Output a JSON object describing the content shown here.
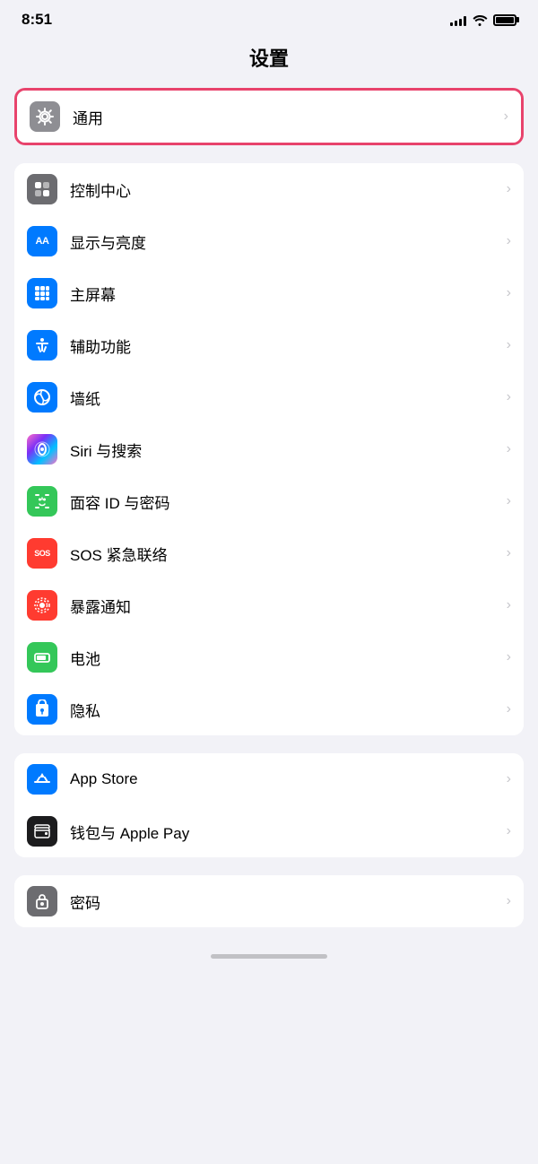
{
  "statusBar": {
    "time": "8:51",
    "signalBars": [
      4,
      6,
      8,
      10,
      12
    ],
    "batteryFull": true
  },
  "pageTitle": "设置",
  "sections": [
    {
      "id": "section-general",
      "highlighted": true,
      "rows": [
        {
          "id": "general",
          "label": "通用",
          "iconBg": "#8e8e93",
          "iconType": "gear"
        }
      ]
    },
    {
      "id": "section-display",
      "rows": [
        {
          "id": "control-center",
          "label": "控制中心",
          "iconBg": "#6c6c70",
          "iconType": "control"
        },
        {
          "id": "display",
          "label": "显示与亮度",
          "iconBg": "#007aff",
          "iconType": "aa"
        },
        {
          "id": "home-screen",
          "label": "主屏幕",
          "iconBg": "#007aff",
          "iconType": "home"
        },
        {
          "id": "accessibility",
          "label": "辅助功能",
          "iconBg": "#007aff",
          "iconType": "accessibility"
        },
        {
          "id": "wallpaper",
          "label": "墙纸",
          "iconBg": "#007aff",
          "iconType": "wallpaper"
        },
        {
          "id": "siri",
          "label": "Siri 与搜索",
          "iconBg": "#000",
          "iconType": "siri"
        },
        {
          "id": "faceid",
          "label": "面容 ID 与密码",
          "iconBg": "#34c759",
          "iconType": "faceid"
        },
        {
          "id": "sos",
          "label": "SOS 紧急联络",
          "iconBg": "#ff3b30",
          "iconType": "sos"
        },
        {
          "id": "exposure",
          "label": "暴露通知",
          "iconBg": "#ff3b30",
          "iconType": "exposure"
        },
        {
          "id": "battery",
          "label": "电池",
          "iconBg": "#34c759",
          "iconType": "battery"
        },
        {
          "id": "privacy",
          "label": "隐私",
          "iconBg": "#007aff",
          "iconType": "privacy"
        }
      ]
    },
    {
      "id": "section-apps",
      "rows": [
        {
          "id": "appstore",
          "label": "App Store",
          "iconBg": "#007aff",
          "iconType": "appstore"
        },
        {
          "id": "wallet",
          "label": "钱包与 Apple Pay",
          "iconBg": "#1c1c1e",
          "iconType": "wallet"
        }
      ]
    },
    {
      "id": "section-passwords",
      "rows": [
        {
          "id": "passwords",
          "label": "密码",
          "iconBg": "#6c6c70",
          "iconType": "passwords"
        }
      ]
    }
  ],
  "chevron": "›",
  "colors": {
    "highlight": "#e8436c",
    "background": "#f2f2f7",
    "rowBg": "#ffffff",
    "separator": "#c6c6c8",
    "labelColor": "#000000",
    "chevronColor": "#c7c7cc"
  }
}
